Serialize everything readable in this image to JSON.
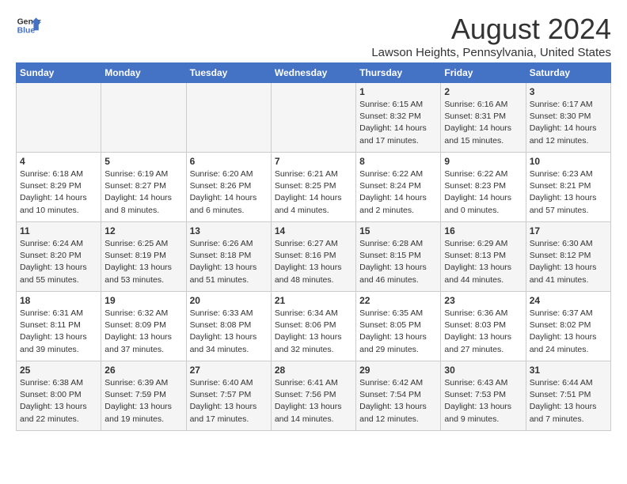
{
  "header": {
    "logo_line1": "General",
    "logo_line2": "Blue",
    "month_year": "August 2024",
    "location": "Lawson Heights, Pennsylvania, United States"
  },
  "weekdays": [
    "Sunday",
    "Monday",
    "Tuesday",
    "Wednesday",
    "Thursday",
    "Friday",
    "Saturday"
  ],
  "weeks": [
    [
      {
        "day": "",
        "content": ""
      },
      {
        "day": "",
        "content": ""
      },
      {
        "day": "",
        "content": ""
      },
      {
        "day": "",
        "content": ""
      },
      {
        "day": "1",
        "content": "Sunrise: 6:15 AM\nSunset: 8:32 PM\nDaylight: 14 hours\nand 17 minutes."
      },
      {
        "day": "2",
        "content": "Sunrise: 6:16 AM\nSunset: 8:31 PM\nDaylight: 14 hours\nand 15 minutes."
      },
      {
        "day": "3",
        "content": "Sunrise: 6:17 AM\nSunset: 8:30 PM\nDaylight: 14 hours\nand 12 minutes."
      }
    ],
    [
      {
        "day": "4",
        "content": "Sunrise: 6:18 AM\nSunset: 8:29 PM\nDaylight: 14 hours\nand 10 minutes."
      },
      {
        "day": "5",
        "content": "Sunrise: 6:19 AM\nSunset: 8:27 PM\nDaylight: 14 hours\nand 8 minutes."
      },
      {
        "day": "6",
        "content": "Sunrise: 6:20 AM\nSunset: 8:26 PM\nDaylight: 14 hours\nand 6 minutes."
      },
      {
        "day": "7",
        "content": "Sunrise: 6:21 AM\nSunset: 8:25 PM\nDaylight: 14 hours\nand 4 minutes."
      },
      {
        "day": "8",
        "content": "Sunrise: 6:22 AM\nSunset: 8:24 PM\nDaylight: 14 hours\nand 2 minutes."
      },
      {
        "day": "9",
        "content": "Sunrise: 6:22 AM\nSunset: 8:23 PM\nDaylight: 14 hours\nand 0 minutes."
      },
      {
        "day": "10",
        "content": "Sunrise: 6:23 AM\nSunset: 8:21 PM\nDaylight: 13 hours\nand 57 minutes."
      }
    ],
    [
      {
        "day": "11",
        "content": "Sunrise: 6:24 AM\nSunset: 8:20 PM\nDaylight: 13 hours\nand 55 minutes."
      },
      {
        "day": "12",
        "content": "Sunrise: 6:25 AM\nSunset: 8:19 PM\nDaylight: 13 hours\nand 53 minutes."
      },
      {
        "day": "13",
        "content": "Sunrise: 6:26 AM\nSunset: 8:18 PM\nDaylight: 13 hours\nand 51 minutes."
      },
      {
        "day": "14",
        "content": "Sunrise: 6:27 AM\nSunset: 8:16 PM\nDaylight: 13 hours\nand 48 minutes."
      },
      {
        "day": "15",
        "content": "Sunrise: 6:28 AM\nSunset: 8:15 PM\nDaylight: 13 hours\nand 46 minutes."
      },
      {
        "day": "16",
        "content": "Sunrise: 6:29 AM\nSunset: 8:13 PM\nDaylight: 13 hours\nand 44 minutes."
      },
      {
        "day": "17",
        "content": "Sunrise: 6:30 AM\nSunset: 8:12 PM\nDaylight: 13 hours\nand 41 minutes."
      }
    ],
    [
      {
        "day": "18",
        "content": "Sunrise: 6:31 AM\nSunset: 8:11 PM\nDaylight: 13 hours\nand 39 minutes."
      },
      {
        "day": "19",
        "content": "Sunrise: 6:32 AM\nSunset: 8:09 PM\nDaylight: 13 hours\nand 37 minutes."
      },
      {
        "day": "20",
        "content": "Sunrise: 6:33 AM\nSunset: 8:08 PM\nDaylight: 13 hours\nand 34 minutes."
      },
      {
        "day": "21",
        "content": "Sunrise: 6:34 AM\nSunset: 8:06 PM\nDaylight: 13 hours\nand 32 minutes."
      },
      {
        "day": "22",
        "content": "Sunrise: 6:35 AM\nSunset: 8:05 PM\nDaylight: 13 hours\nand 29 minutes."
      },
      {
        "day": "23",
        "content": "Sunrise: 6:36 AM\nSunset: 8:03 PM\nDaylight: 13 hours\nand 27 minutes."
      },
      {
        "day": "24",
        "content": "Sunrise: 6:37 AM\nSunset: 8:02 PM\nDaylight: 13 hours\nand 24 minutes."
      }
    ],
    [
      {
        "day": "25",
        "content": "Sunrise: 6:38 AM\nSunset: 8:00 PM\nDaylight: 13 hours\nand 22 minutes."
      },
      {
        "day": "26",
        "content": "Sunrise: 6:39 AM\nSunset: 7:59 PM\nDaylight: 13 hours\nand 19 minutes."
      },
      {
        "day": "27",
        "content": "Sunrise: 6:40 AM\nSunset: 7:57 PM\nDaylight: 13 hours\nand 17 minutes."
      },
      {
        "day": "28",
        "content": "Sunrise: 6:41 AM\nSunset: 7:56 PM\nDaylight: 13 hours\nand 14 minutes."
      },
      {
        "day": "29",
        "content": "Sunrise: 6:42 AM\nSunset: 7:54 PM\nDaylight: 13 hours\nand 12 minutes."
      },
      {
        "day": "30",
        "content": "Sunrise: 6:43 AM\nSunset: 7:53 PM\nDaylight: 13 hours\nand 9 minutes."
      },
      {
        "day": "31",
        "content": "Sunrise: 6:44 AM\nSunset: 7:51 PM\nDaylight: 13 hours\nand 7 minutes."
      }
    ]
  ]
}
